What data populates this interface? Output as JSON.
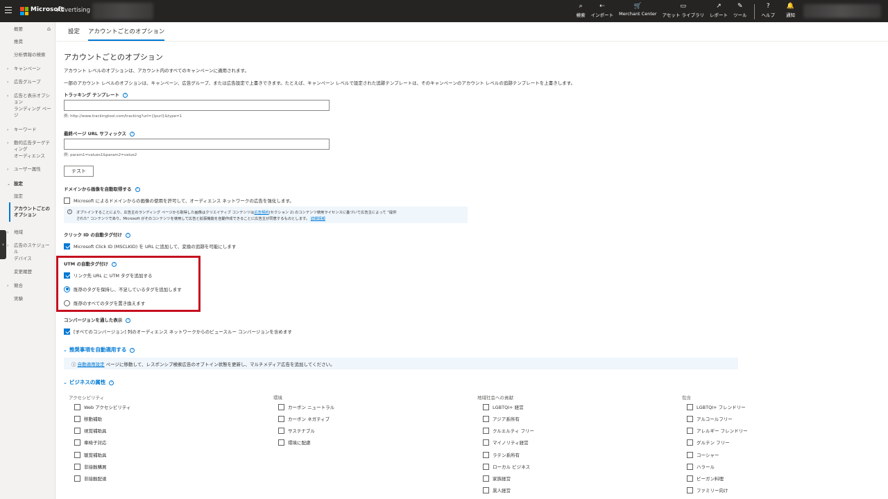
{
  "topbar": {
    "brand": "Microsoft",
    "brand_sub": "Advertising",
    "nav": [
      {
        "icon": "⌕",
        "label": "検索"
      },
      {
        "icon": "⇠",
        "label": "インポート"
      },
      {
        "icon": "🛒",
        "label": "Merchant Center"
      },
      {
        "icon": "▭",
        "label": "アセット ライブラリ"
      },
      {
        "icon": "↗",
        "label": "レポート"
      },
      {
        "icon": "✎",
        "label": "ツール"
      },
      {
        "icon": "?",
        "label": "ヘルプ"
      },
      {
        "icon": "🔔",
        "label": "通知"
      }
    ]
  },
  "sidebar": {
    "items": [
      {
        "label": "概要"
      },
      {
        "label": "推奨"
      },
      {
        "label": "分析情報の検索"
      },
      {
        "label": "キャンペーン"
      },
      {
        "label": "広告グループ"
      },
      {
        "label": "広告と表示オプション"
      },
      {
        "label": "ランディング ページ"
      },
      {
        "label": "キーワード"
      },
      {
        "label": "動的広告ターゲティング"
      },
      {
        "label": "オーディエンス"
      },
      {
        "label": "ユーザー属性"
      },
      {
        "label": "設定"
      },
      {
        "label": "設定"
      },
      {
        "label": "アカウントごとのオプション"
      },
      {
        "label": "地域"
      },
      {
        "label": "広告のスケジュール"
      },
      {
        "label": "デバイス"
      },
      {
        "label": "変更履歴"
      },
      {
        "label": "競合"
      },
      {
        "label": "実験"
      }
    ]
  },
  "tabs": [
    {
      "label": "設定"
    },
    {
      "label": "アカウントごとのオプション"
    }
  ],
  "page": {
    "title": "アカウントごとのオプション",
    "desc1": "アカウント レベルのオプションは、アカウント内のすべてのキャンペーンに適用されます。",
    "desc2": "一部のアカウント レベルのオプションは、キャンペーン、広告グループ、または広告設定で上書きできます。たとえば、キャンペーン レベルで設定された追跡テンプレートは、そのキャンペーンのアカウント レベルの追跡テンプレートを上書きします。",
    "tracking_title": "トラッキング テンプレート",
    "tracking_value": "",
    "tracking_hint": "例: http://www.trackingtool.com/tracking?url={lpurl}&type=1",
    "suffix_title": "最終ページ URL サフィックス",
    "suffix_value": "",
    "suffix_hint": "例: param1=values1&param2=value2",
    "test_button": "テスト",
    "image_title": "ドメインから画像を自動取得する",
    "image_check": "Microsoft によるドメインからの画像の使用を許可して、オーディエンス ネットワークの広告を強化します。",
    "image_info1a": "オプトインすることにより、広告主のランディング ページから取得した画像はクリエイティブ コンテンツは",
    "image_info1_link": "広告契約",
    "image_info1b": "(セクション 2) のコンテンツ使用ライセンスに基づいて広告主によって \"提供",
    "image_info2a": "された\" コンテンツであり、Microsoft がそのコンテンツを使用して広告と拡張機能を自動作成できることに広告主が同意するものとします。",
    "image_info2_link": "詳細情報",
    "msclkid_title": "クリック ID の自動タグ付け",
    "msclkid_check": "Microsoft Click ID (MSCLKID) を URL に追加して、変換の追跡を可能にします",
    "utm_title": "UTM の自動タグ付け",
    "utm_check": "リンク先 URL に UTM タグを追加する",
    "utm_radio1": "既存のタグを保持し、不足しているタグを追加します",
    "utm_radio2": "既存のすべてのタグを置き換えます",
    "vt_title": "コンバージョンを通した表示",
    "vt_check": "[すべてのコンバージョン] 列のオーディエンス ネットワークからのビュースルー コンバージョンを含めます",
    "auto_title": "推奨事項を自動適用する",
    "auto_link": "自動適用設定",
    "auto_text": "ページに移動して、レスポンシブ検索広告のオプトイン状態を更新し、マルチメディア広告を追加してください。",
    "biz_title": "ビジネスの属性"
  },
  "business": {
    "columns": [
      {
        "title": "アクセシビリティ",
        "items": [
          "Web アクセシビリティ",
          "移動補助",
          "視覚補助具",
          "車椅子対応",
          "聴覚補助具",
          "非接触購買",
          "非接触配達"
        ]
      },
      {
        "title": "環境",
        "items": [
          "カーボン ニュートラル",
          "カーボン ネガティブ",
          "サステナブル",
          "環境に配慮"
        ]
      },
      {
        "title": "地域社会への貢献",
        "items": [
          "LGBTQI+ 経営",
          "アジア系所有",
          "クルエルティ フリー",
          "マイノリティ経営",
          "ラテン系所有",
          "ローカル ビジネス",
          "家族経営",
          "黒人経営"
        ]
      },
      {
        "title": "包含",
        "items": [
          "LGBTQI+ フレンドリー",
          "アルコールフリー",
          "アレルギー フレンドリー",
          "グルテン フリー",
          "コーシャー",
          "ハラール",
          "ビーガン料理",
          "ファミリー向け"
        ]
      }
    ]
  }
}
